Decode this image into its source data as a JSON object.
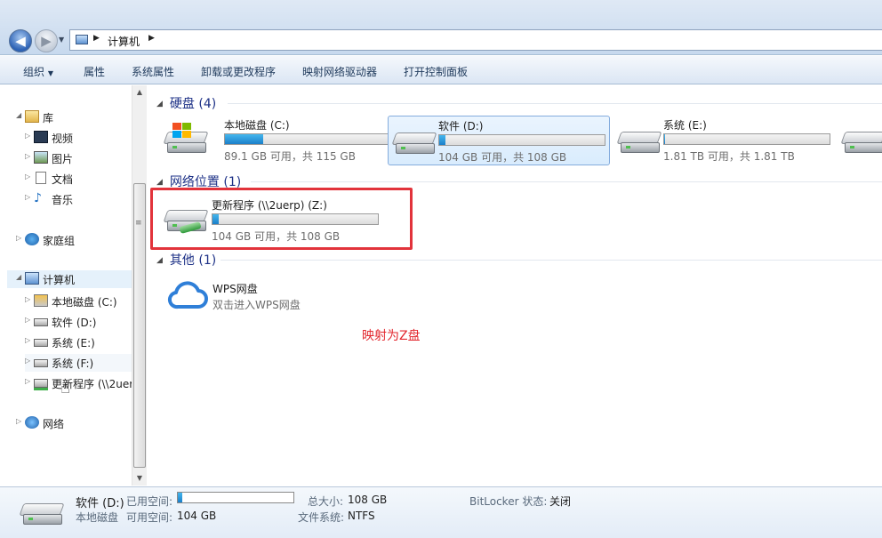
{
  "address": {
    "location": "计算机",
    "computer_icon": "computer-icon"
  },
  "toolbar": {
    "organize": "组织",
    "properties": "属性",
    "system_properties": "系统属性",
    "uninstall": "卸载或更改程序",
    "map_drive": "映射网络驱动器",
    "control_panel": "打开控制面板"
  },
  "nav": {
    "library": "库",
    "videos": "视频",
    "pictures": "图片",
    "documents": "文档",
    "music": "音乐",
    "homegroup": "家庭组",
    "computer": "计算机",
    "drive_c": "本地磁盘 (C:)",
    "drive_d": "软件 (D:)",
    "drive_e": "系统 (E:)",
    "drive_f": "系统 (F:)",
    "drive_z": "更新程序 (\\\\2uer",
    "network": "网络"
  },
  "groups": {
    "hard_disks": "硬盘 (4)",
    "network_locations": "网络位置 (1)",
    "other": "其他 (1)"
  },
  "drives": [
    {
      "name": "本地磁盘 (C:)",
      "info": "89.1 GB 可用，共 115 GB",
      "used_fraction": 0.23
    },
    {
      "name": "软件 (D:)",
      "info": "104 GB 可用，共 108 GB",
      "used_fraction": 0.04
    },
    {
      "name": "系统 (E:)",
      "info": "1.81 TB 可用，共 1.81 TB",
      "used_fraction": 0.0
    }
  ],
  "network_drive": {
    "name": "更新程序 (\\\\2uerp) (Z:)",
    "info": "104 GB 可用，共 108 GB",
    "used_fraction": 0.04
  },
  "wps": {
    "name": "WPS网盘",
    "subtitle": "双击进入WPS网盘"
  },
  "annotation": "映射为Z盘",
  "details": {
    "name": "软件 (D:)",
    "type": "本地磁盘",
    "used_label": "已用空间:",
    "free_label": "可用空间:",
    "free_value": "104 GB",
    "total_label": "总大小:",
    "total_value": "108 GB",
    "fs_label": "文件系统:",
    "fs_value": "NTFS",
    "bitlocker_label": "BitLocker 状态:",
    "bitlocker_value": "关闭",
    "used_fraction": 0.04
  },
  "colors": {
    "accent": "#1e3287",
    "highlight_box": "#e2333b",
    "annotation": "#e2272e"
  }
}
